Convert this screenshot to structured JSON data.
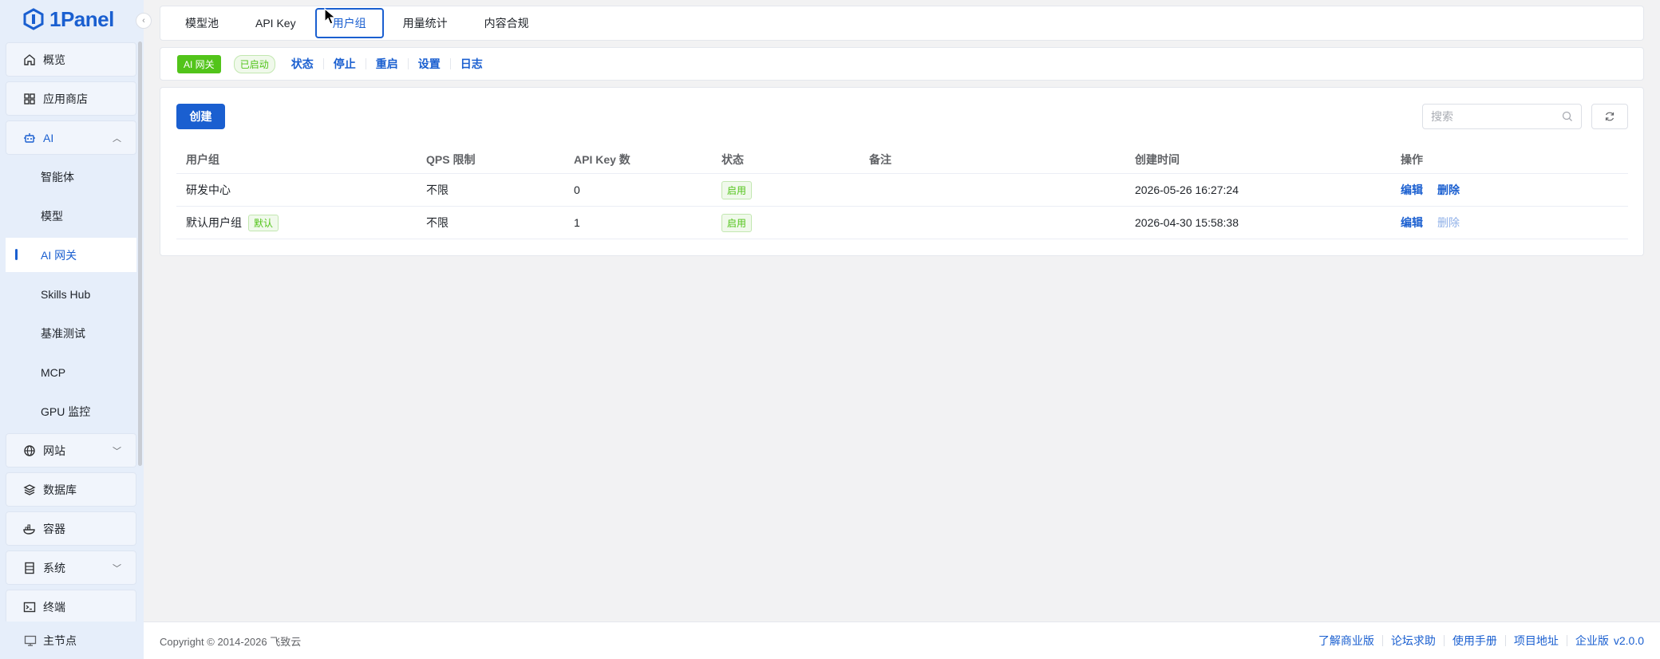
{
  "brand": {
    "name": "1Panel"
  },
  "sidebar": {
    "items": [
      {
        "label": "概览",
        "icon": "home-icon"
      },
      {
        "label": "应用商店",
        "icon": "grid-icon"
      },
      {
        "label": "AI",
        "icon": "robot-icon",
        "expanded": true,
        "children": [
          {
            "label": "智能体"
          },
          {
            "label": "模型"
          },
          {
            "label": "AI 网关",
            "active": true
          },
          {
            "label": "Skills Hub"
          },
          {
            "label": "基准测试"
          },
          {
            "label": "MCP"
          },
          {
            "label": "GPU 监控"
          }
        ]
      },
      {
        "label": "网站",
        "icon": "globe-icon"
      },
      {
        "label": "数据库",
        "icon": "database-icon"
      },
      {
        "label": "容器",
        "icon": "container-icon"
      },
      {
        "label": "系统",
        "icon": "server-icon"
      },
      {
        "label": "终端",
        "icon": "terminal-icon"
      }
    ],
    "footer": {
      "label": "主节点",
      "icon": "monitor-icon"
    }
  },
  "tabs": [
    {
      "label": "模型池"
    },
    {
      "label": "API Key"
    },
    {
      "label": "用户组",
      "active": true
    },
    {
      "label": "用量统计"
    },
    {
      "label": "内容合规"
    }
  ],
  "app_bar": {
    "app_tag": "AI 网关",
    "status_tag": "已启动",
    "actions": [
      "状态",
      "停止",
      "重启",
      "设置",
      "日志"
    ]
  },
  "toolbar": {
    "create_label": "创建",
    "search_placeholder": "搜索"
  },
  "table": {
    "headers": [
      "用户组",
      "QPS 限制",
      "API Key 数",
      "状态",
      "备注",
      "创建时间",
      "操作"
    ],
    "rows": [
      {
        "group": "研发中心",
        "default_tag": "",
        "qps": "不限",
        "key_count": "0",
        "status": "启用",
        "note": "",
        "created": "2026-05-26 16:27:24",
        "edit": "编辑",
        "delete": "删除",
        "delete_disabled": false
      },
      {
        "group": "默认用户组",
        "default_tag": "默认",
        "qps": "不限",
        "key_count": "1",
        "status": "启用",
        "note": "",
        "created": "2026-04-30 15:58:38",
        "edit": "编辑",
        "delete": "删除",
        "delete_disabled": true
      }
    ]
  },
  "footer": {
    "copyright": "Copyright © 2014-2026 飞致云",
    "links": [
      "了解商业版",
      "论坛求助",
      "使用手册",
      "项目地址",
      "企业版"
    ],
    "version": "v2.0.0"
  },
  "colors": {
    "primary": "#1a5fd0",
    "success": "#52c41a",
    "sidebar_bg": "#e6eefa"
  }
}
